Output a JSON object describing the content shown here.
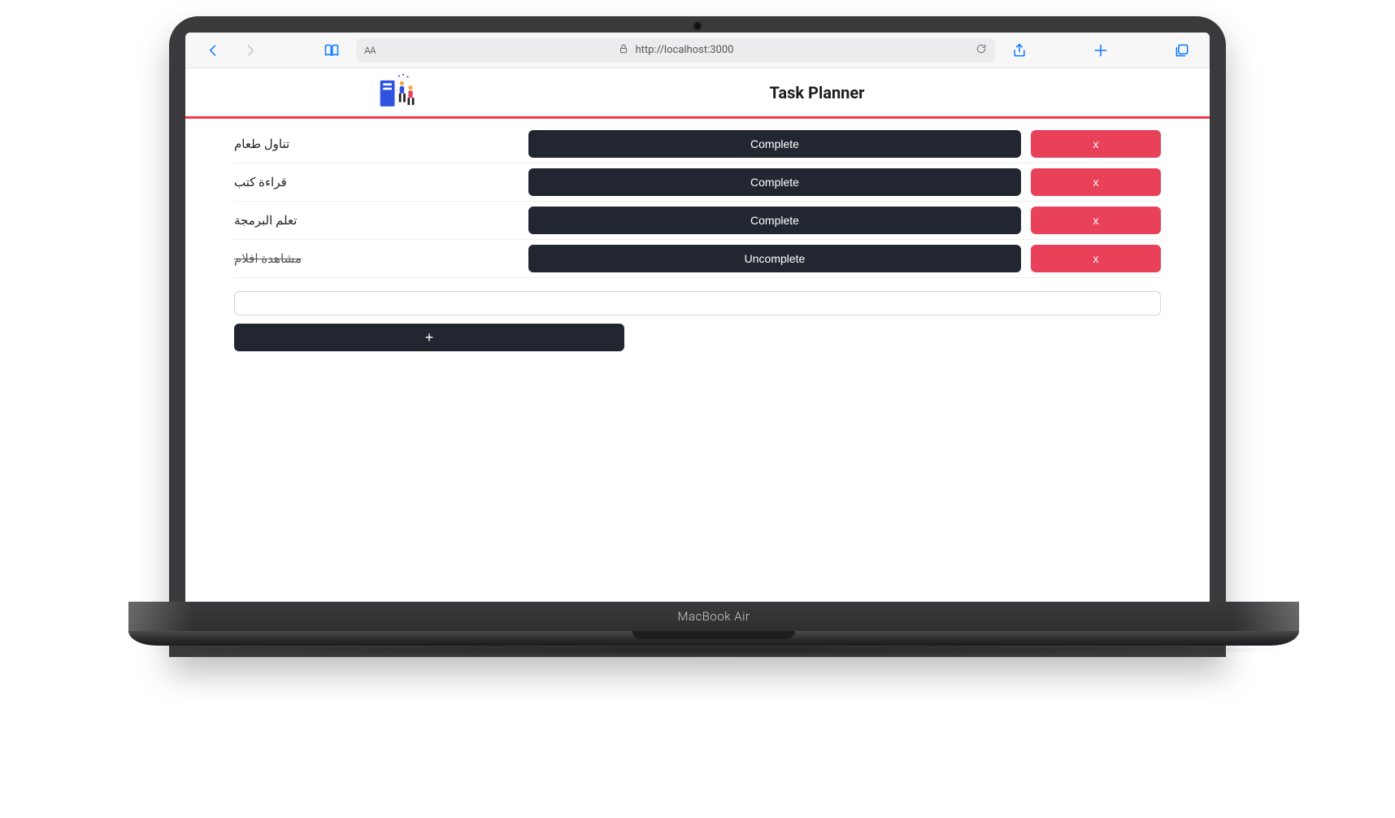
{
  "device": {
    "label": "MacBook Air"
  },
  "browser": {
    "aa": "AA",
    "url": "http://localhost:3000",
    "icons": {
      "back": "back-icon",
      "forward": "forward-icon",
      "bookmarks": "book-icon",
      "lock": "lock-icon",
      "reload": "reload-icon",
      "share": "share-icon",
      "new_tab": "plus-icon",
      "tabs": "tabs-icon"
    }
  },
  "app": {
    "title": "Task Planner",
    "add_button": "+",
    "new_task_value": "",
    "buttons": {
      "complete": "Complete",
      "uncomplete": "Uncomplete",
      "delete": "x"
    },
    "tasks": [
      {
        "label": "تناول طعام",
        "done": false
      },
      {
        "label": "قراءة كتب",
        "done": false
      },
      {
        "label": "تعلم البرمجة",
        "done": false
      },
      {
        "label": "مشاهدة افلام",
        "done": true
      }
    ]
  },
  "colors": {
    "accent_red": "#ee3b4a",
    "danger": "#e9415a",
    "dark": "#222630",
    "ios_blue": "#0a7aff"
  }
}
